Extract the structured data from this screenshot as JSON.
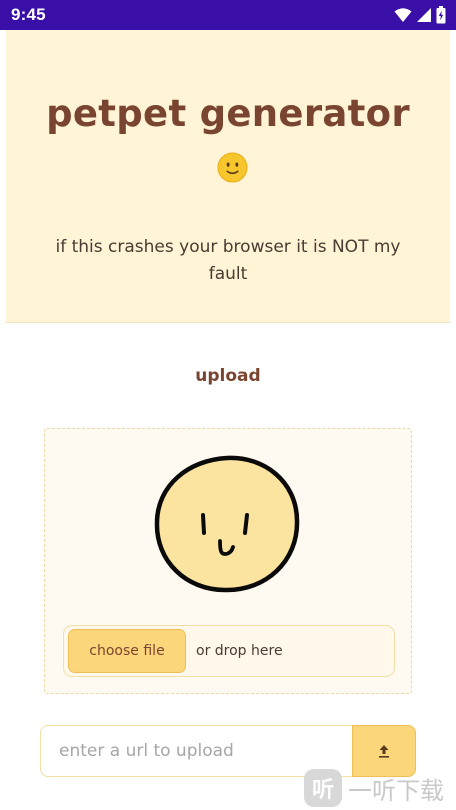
{
  "status_bar": {
    "time": "9:45",
    "icons": [
      "wifi-icon",
      "signal-icon",
      "battery-icon"
    ],
    "background": "#3a0fa8"
  },
  "hero": {
    "title": "petpet generator",
    "emoji_icon": "slightly-smiling-face-emoji",
    "subtitle": "if this crashes your browser it is NOT my fault",
    "background": "#fff4d6",
    "title_color": "#7a4530"
  },
  "upload": {
    "heading": "upload",
    "preview_icon": "drawn-smiley-face",
    "choose_file_label": "choose file",
    "drop_label": "or drop here",
    "accent": "#fcd67a"
  },
  "url_upload": {
    "placeholder": "enter a url to upload",
    "submit_icon": "upload-arrow-icon"
  },
  "watermark": {
    "mark": "听",
    "text": "一听下载"
  }
}
